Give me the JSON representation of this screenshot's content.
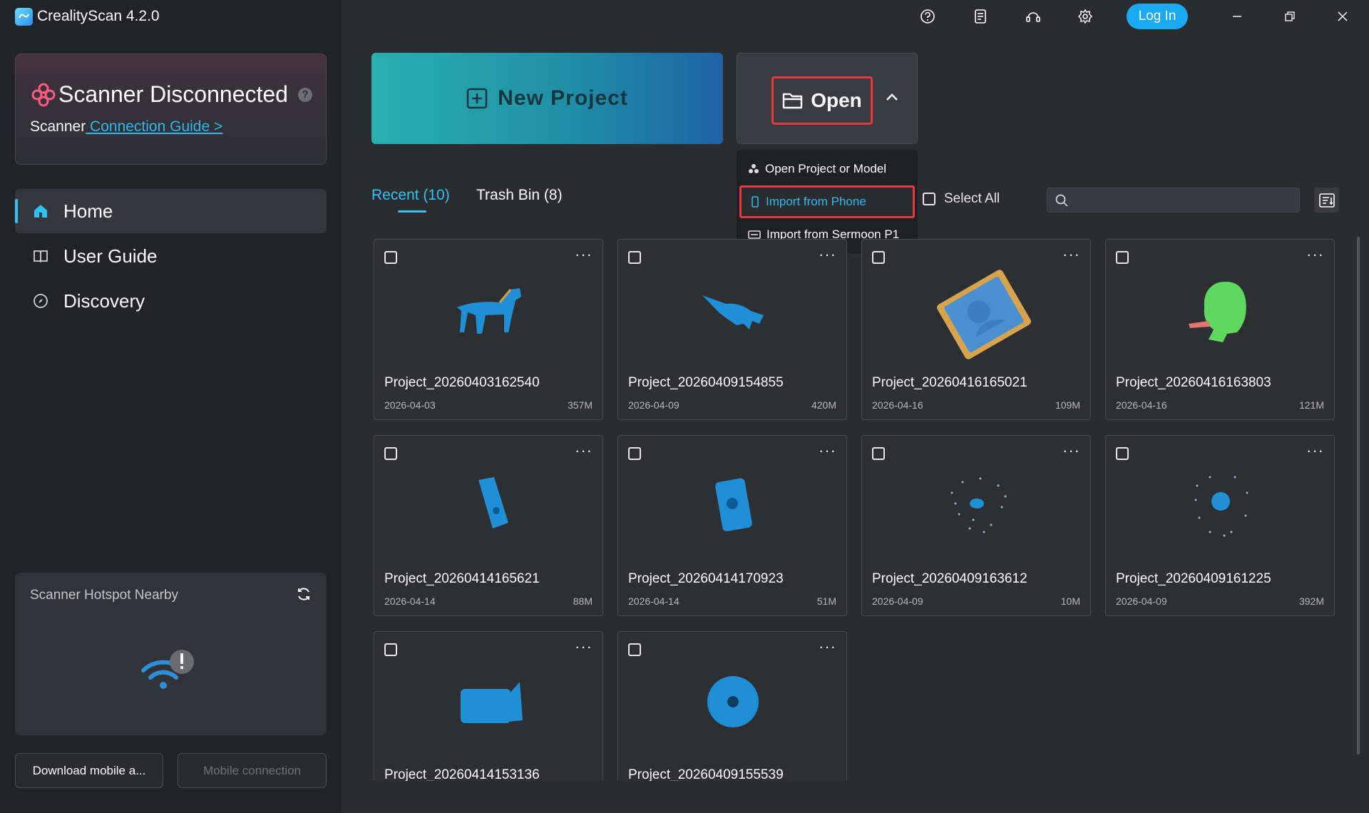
{
  "app": {
    "title": "CrealityScan 4.2.0"
  },
  "status_card": {
    "title": "Scanner Disconnected",
    "prefix": "Scanner",
    "link": " Connection Guide >"
  },
  "nav": [
    {
      "label": "Home",
      "icon": "home-icon",
      "active": true
    },
    {
      "label": "User Guide",
      "icon": "book-icon",
      "active": false
    },
    {
      "label": "Discovery",
      "icon": "compass-icon",
      "active": false
    }
  ],
  "hotspot": {
    "title": "Scanner Hotspot Nearby"
  },
  "bottom_buttons": {
    "download": "Download mobile a...",
    "mobile": "Mobile connection"
  },
  "titlebar": {
    "login": "Log In"
  },
  "actions": {
    "new_project": "New Project",
    "open": "Open"
  },
  "open_menu": {
    "items": [
      {
        "label": "Open Project or Model",
        "icon": "model-icon"
      },
      {
        "label": "Import from Phone",
        "icon": "phone-icon"
      },
      {
        "label": "Import from Sermoon P1",
        "icon": "printer-icon"
      }
    ]
  },
  "tabs": {
    "recent": "Recent (10)",
    "trash": "Trash Bin (8)"
  },
  "toolbar": {
    "select_all": "Select All",
    "search_placeholder": ""
  },
  "projects": [
    {
      "name": "Project_20260403162540",
      "date": "2026-04-03",
      "size": "357M",
      "model": "horse"
    },
    {
      "name": "Project_20260409154855",
      "date": "2026-04-09",
      "size": "420M",
      "model": "bull"
    },
    {
      "name": "Project_20260416165021",
      "date": "2026-04-16",
      "size": "109M",
      "model": "relief"
    },
    {
      "name": "Project_20260416163803",
      "date": "2026-04-16",
      "size": "121M",
      "model": "bust"
    },
    {
      "name": "Project_20260414165621",
      "date": "2026-04-14",
      "size": "88M",
      "model": "block"
    },
    {
      "name": "Project_20260414170923",
      "date": "2026-04-14",
      "size": "51M",
      "model": "tile"
    },
    {
      "name": "Project_20260409163612",
      "date": "2026-04-09",
      "size": "10M",
      "model": "points"
    },
    {
      "name": "Project_20260409161225",
      "date": "2026-04-09",
      "size": "392M",
      "model": "points2"
    },
    {
      "name": "Project_20260414153136",
      "date": "",
      "size": "",
      "model": "box"
    },
    {
      "name": "Project_20260409155539",
      "date": "",
      "size": "",
      "model": "disc"
    }
  ],
  "colors": {
    "accent": "#2fc2f3",
    "highlight_border": "#e3393f",
    "model_blue": "#1f8fd6",
    "model_green": "#5ed85e"
  }
}
